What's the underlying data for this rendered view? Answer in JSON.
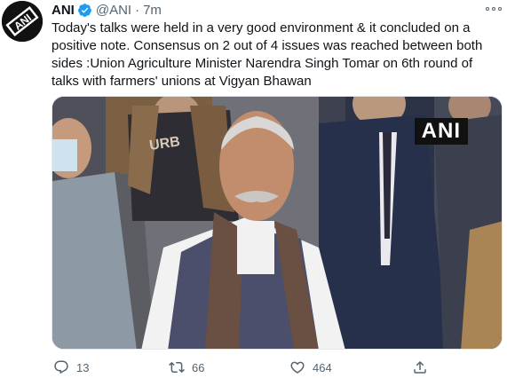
{
  "tweet": {
    "author_name": "ANI",
    "handle": "@ANI",
    "separator": "·",
    "time": "7m",
    "text": "Today's talks were held in a very good environment & it concluded on a positive note. Consensus on 2 out of 4 issues was reached between both sides :Union Agriculture Minister Narendra Singh Tomar on 6th round of talks with farmers' unions at Vigyan Bhawan",
    "media": {
      "watermark": "ANI",
      "scarf_text": "URB"
    },
    "avatar_logo_text": "ANI"
  },
  "actions": {
    "reply_count": "13",
    "retweet_count": "66",
    "like_count": "464"
  },
  "colors": {
    "accent": "#1d9bf0",
    "secondary_text": "#536471",
    "primary_text": "#0f1419"
  },
  "icons": [
    "more-icon",
    "verified-badge-icon",
    "reply-icon",
    "retweet-icon",
    "like-icon",
    "share-icon"
  ]
}
